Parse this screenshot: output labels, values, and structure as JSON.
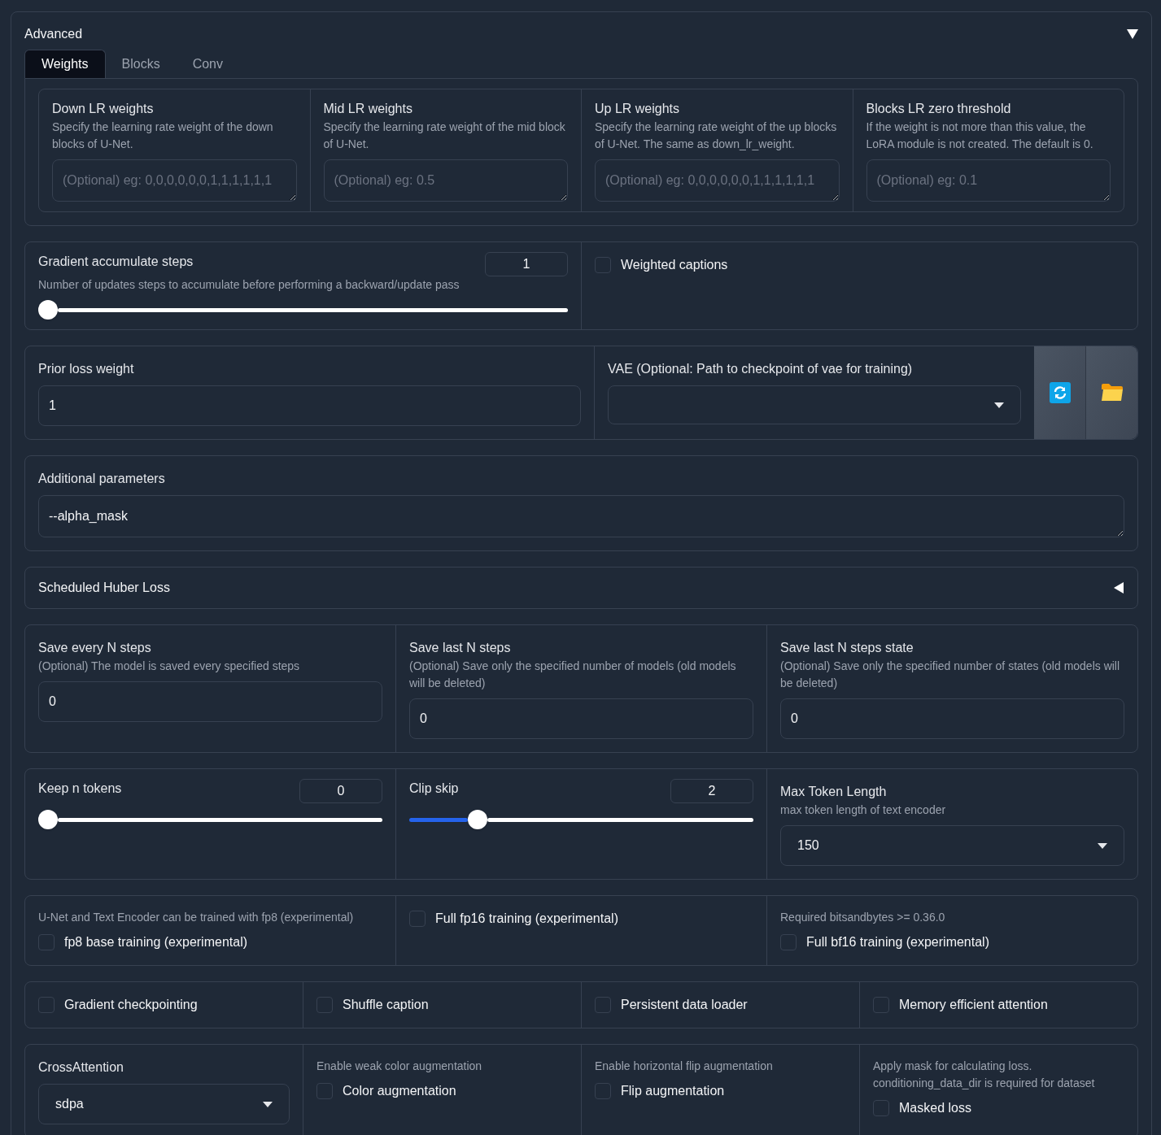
{
  "accordion": {
    "title": "Advanced",
    "expanded": true
  },
  "tabs": [
    {
      "label": "Weights",
      "selected": true
    },
    {
      "label": "Blocks",
      "selected": false
    },
    {
      "label": "Conv",
      "selected": false
    }
  ],
  "tab_fields": [
    {
      "label": "Down LR weights",
      "info": "Specify the learning rate weight of the down blocks of U-Net.",
      "placeholder": "(Optional) eg: 0,0,0,0,0,0,1,1,1,1,1,1"
    },
    {
      "label": "Mid LR weights",
      "info": "Specify the learning rate weight of the mid block of U-Net.",
      "placeholder": "(Optional) eg: 0.5"
    },
    {
      "label": "Up LR weights",
      "info": "Specify the learning rate weight of the up blocks of U-Net. The same as down_lr_weight.",
      "placeholder": "(Optional) eg: 0,0,0,0,0,0,1,1,1,1,1,1"
    },
    {
      "label": "Blocks LR zero threshold",
      "info": "If the weight is not more than this value, the LoRA module is not created. The default is 0.",
      "placeholder": "(Optional) eg: 0.1"
    }
  ],
  "rows": [
    {
      "kind": "group",
      "cells": [
        {
          "kind": "slider",
          "label": "Gradient accumulate steps",
          "info": "Number of updates steps to accumulate before performing a backward/update pass",
          "value": "1",
          "level": 0
        },
        {
          "kind": "checkbox",
          "label": "Weighted captions",
          "checked": false
        }
      ]
    },
    {
      "kind": "group",
      "cells": [
        {
          "kind": "textbox",
          "label": "Prior loss weight",
          "value": "1"
        },
        {
          "kind": "file_dropdown",
          "label": "VAE (Optional: Path to checkpoint of vae for training)"
        }
      ]
    },
    {
      "kind": "group",
      "cells": [
        {
          "kind": "textarea",
          "label": "Additional parameters",
          "value": "--alpha_mask"
        }
      ]
    },
    {
      "kind": "accordion",
      "title": "Scheduled Huber Loss",
      "expanded": false
    },
    {
      "kind": "group",
      "cells": [
        {
          "kind": "textbox",
          "label": "Save every N steps",
          "info": "(Optional) The model is saved every specified steps",
          "value": "0"
        },
        {
          "kind": "textbox",
          "label": "Save last N steps",
          "info": "(Optional) Save only the specified number of models (old models will be deleted)",
          "value": "0"
        },
        {
          "kind": "textbox",
          "label": "Save last N steps state",
          "info": "(Optional) Save only the specified number of states (old models will be deleted)",
          "value": "0"
        }
      ]
    },
    {
      "kind": "group",
      "cells": [
        {
          "kind": "slider",
          "label": "Keep n tokens",
          "value": "0",
          "level": 0
        },
        {
          "kind": "slider",
          "label": "Clip skip",
          "value": "2",
          "level": 0.18
        },
        {
          "kind": "dropdown",
          "label": "Max Token Length",
          "info": "max token length of text encoder",
          "value": "150"
        }
      ]
    },
    {
      "kind": "group",
      "cells": [
        {
          "kind": "checkbox",
          "info": "U-Net and Text Encoder can be trained with fp8 (experimental)",
          "label": "fp8 base training (experimental)",
          "checked": false
        },
        {
          "kind": "checkbox",
          "label": "Full fp16 training (experimental)",
          "checked": false
        },
        {
          "kind": "checkbox",
          "info": "Required bitsandbytes >= 0.36.0",
          "label": "Full bf16 training (experimental)",
          "checked": false
        }
      ]
    },
    {
      "kind": "group",
      "cells": [
        {
          "kind": "checkbox",
          "label": "Gradient checkpointing",
          "checked": false
        },
        {
          "kind": "checkbox",
          "label": "Shuffle caption",
          "checked": false
        },
        {
          "kind": "checkbox",
          "label": "Persistent data loader",
          "checked": false
        },
        {
          "kind": "checkbox",
          "label": "Memory efficient attention",
          "checked": false
        }
      ]
    },
    {
      "kind": "group",
      "cells": [
        {
          "kind": "dropdown",
          "label": "CrossAttention",
          "value": "sdpa"
        },
        {
          "kind": "checkbox",
          "info": "Enable weak color augmentation",
          "label": "Color augmentation",
          "checked": false
        },
        {
          "kind": "checkbox",
          "info": "Enable horizontal flip augmentation",
          "label": "Flip augmentation",
          "checked": false
        },
        {
          "kind": "checkbox",
          "info": "Apply mask for calculating loss. conditioning_data_dir is required for dataset",
          "label": "Masked loss",
          "checked": false
        }
      ]
    }
  ]
}
